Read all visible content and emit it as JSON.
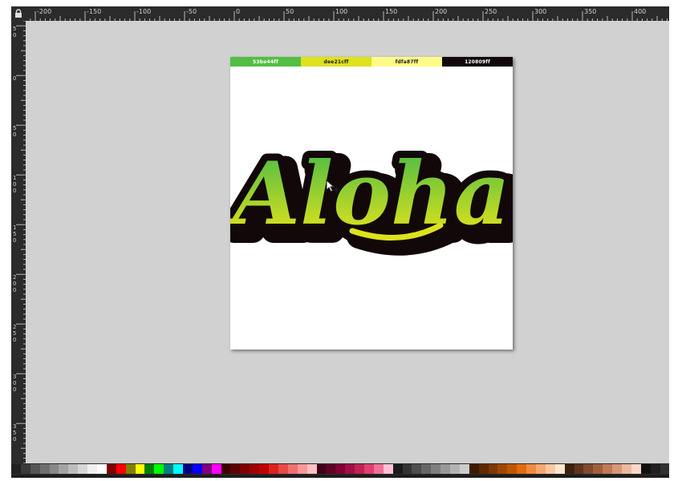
{
  "window": {
    "title": ""
  },
  "ruler": {
    "horizontal_labels": [
      "-200",
      "-150",
      "-100",
      "-50",
      "0",
      "50",
      "100",
      "150",
      "200",
      "250",
      "300",
      "350",
      "400"
    ],
    "vertical_labels": [
      "50",
      "0",
      "50",
      "100",
      "150",
      "200",
      "250",
      "300",
      "350",
      "400"
    ]
  },
  "document": {
    "swatches": [
      {
        "label": "53be44ff",
        "color": "#53be44",
        "text_color": "#ffffff"
      },
      {
        "label": "dee21cff",
        "color": "#dee21c",
        "text_color": "#1a1a1a"
      },
      {
        "label": "fdfa87ff",
        "color": "#fdfa87",
        "text_color": "#1a1a1a"
      },
      {
        "label": "120809ff",
        "color": "#120809",
        "text_color": "#ffffff"
      }
    ],
    "artwork": {
      "text": "Aloha",
      "gradient": [
        "#53be44",
        "#dee21c"
      ],
      "outline": "#120809"
    }
  },
  "palette": {
    "colors": [
      "#202020",
      "#3a3a3a",
      "#555555",
      "#6e6e6e",
      "#888888",
      "#a3a3a3",
      "#bdbdbd",
      "#d7d7d7",
      "#f0f0f0",
      "#ffffff",
      "#800000",
      "#ff0000",
      "#808000",
      "#ffff00",
      "#008000",
      "#00ff00",
      "#008080",
      "#00ffff",
      "#000080",
      "#0000ff",
      "#800080",
      "#ff00ff",
      "#3d0000",
      "#5e0000",
      "#7f0000",
      "#9f0000",
      "#c00000",
      "#e02020",
      "#e84848",
      "#f07070",
      "#f79898",
      "#ffc0c0",
      "#3d0018",
      "#5e0025",
      "#7f0033",
      "#9f1044",
      "#c02255",
      "#e04070",
      "#f0709a",
      "#ffc0d8",
      "#1a1a1a",
      "#333333",
      "#4d4d4d",
      "#666666",
      "#808080",
      "#999999",
      "#b3b3b3",
      "#cccccc",
      "#3d1a00",
      "#5e2800",
      "#7f3700",
      "#a04600",
      "#c05500",
      "#e06a10",
      "#f08a40",
      "#f5a870",
      "#fac8a0",
      "#ffe6d0",
      "#3d2010",
      "#5e3520",
      "#7f4a30",
      "#a06040",
      "#c07a58",
      "#d99878",
      "#ecb8a0",
      "#f8d8c8",
      "#101010",
      "#202020",
      "#303030"
    ]
  }
}
